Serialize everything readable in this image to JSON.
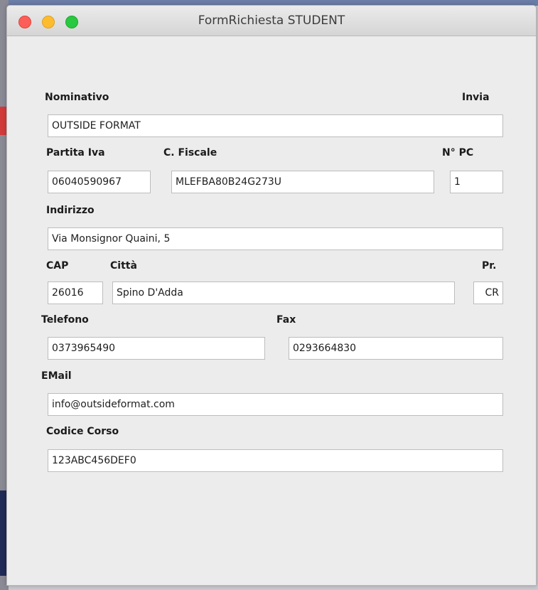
{
  "window": {
    "title": "FormRichiesta STUDENT"
  },
  "form": {
    "nominativo": {
      "label": "Nominativo",
      "value": "OUTSIDE FORMAT"
    },
    "invia": {
      "label": "Invia"
    },
    "partita_iva": {
      "label": "Partita Iva",
      "value": "06040590967"
    },
    "codice_fiscale": {
      "label": "C. Fiscale",
      "value": "MLEFBA80B24G273U"
    },
    "numero_pc": {
      "label": "N° PC",
      "value": "1"
    },
    "indirizzo": {
      "label": "Indirizzo",
      "value": "Via Monsignor Quaini, 5"
    },
    "cap": {
      "label": "CAP",
      "value": "26016"
    },
    "citta": {
      "label": "Città",
      "value": "Spino D'Adda"
    },
    "provincia": {
      "label": "Pr.",
      "value": "CR"
    },
    "telefono": {
      "label": "Telefono",
      "value": "0373965490"
    },
    "fax": {
      "label": "Fax",
      "value": "0293664830"
    },
    "email": {
      "label": "EMail",
      "value": "info@outsideformat.com"
    },
    "codice_corso": {
      "label": "Codice Corso",
      "value": "123ABC456DEF0"
    }
  },
  "colors": {
    "close": "#fc5f57",
    "minimize": "#fdbc2e",
    "zoom": "#28c840",
    "window_bg": "#ececec"
  }
}
